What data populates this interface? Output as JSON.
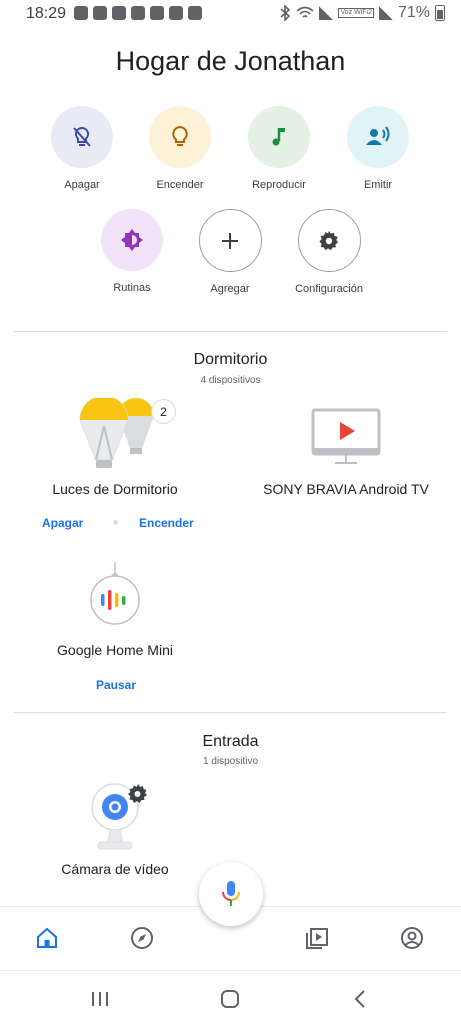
{
  "status": {
    "time": "18:29",
    "battery": "71%",
    "network_badge": "Voz WiFi2"
  },
  "header": {
    "title": "Hogar de Jonathan"
  },
  "quick_actions": [
    {
      "label": "Apagar",
      "icon": "light-off-icon",
      "bg": "#e8eaf6",
      "color": "#3949ab"
    },
    {
      "label": "Encender",
      "icon": "lightbulb-icon",
      "bg": "#fdf1d8",
      "color": "#b06000"
    },
    {
      "label": "Reproducir",
      "icon": "music-note-icon",
      "bg": "#e3f2e5",
      "color": "#1e8e3e"
    },
    {
      "label": "Emitir",
      "icon": "cast-voice-icon",
      "bg": "#e0f4f8",
      "color": "#1176a8"
    },
    {
      "label": "Rutinas",
      "icon": "routines-icon",
      "bg": "#f3e3f8",
      "color": "#9334bf"
    },
    {
      "label": "Agregar",
      "icon": "plus-icon"
    },
    {
      "label": "Configuración",
      "icon": "gear-icon"
    }
  ],
  "rooms": [
    {
      "name": "Dormitorio",
      "count": "4 dispositivos",
      "devices": [
        {
          "name": "Luces de Dormitorio",
          "badge": "2",
          "actions": [
            "Apagar",
            "Encender"
          ]
        },
        {
          "name": "SONY BRAVIA Android TV"
        },
        {
          "name": "Google Home Mini",
          "actions": [
            "Pausar"
          ]
        }
      ]
    },
    {
      "name": "Entrada",
      "count": "1 dispositivo",
      "devices": [
        {
          "name": "Cámara de vídeo"
        }
      ]
    }
  ],
  "colors": {
    "accent": "#1a73e8",
    "text": "#202124",
    "divider": "#dadce0"
  }
}
